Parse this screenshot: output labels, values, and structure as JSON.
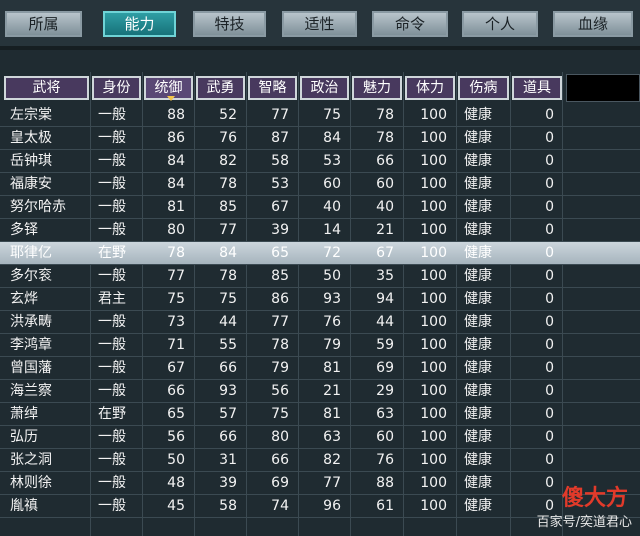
{
  "tabs": [
    {
      "label": "所属",
      "active": false
    },
    {
      "label": "能力",
      "active": true
    },
    {
      "label": "特技",
      "active": false
    },
    {
      "label": "适性",
      "active": false
    },
    {
      "label": "命令",
      "active": false
    },
    {
      "label": "个人",
      "active": false
    },
    {
      "label": "血缘",
      "active": false
    }
  ],
  "columns": [
    "武将",
    "身份",
    "统御",
    "武勇",
    "智略",
    "政治",
    "魅力",
    "体力",
    "伤病",
    "道具"
  ],
  "sorted_column": "统御",
  "rows": [
    [
      "左宗棠",
      "一般",
      "88",
      "52",
      "77",
      "75",
      "78",
      "100",
      "健康",
      "0"
    ],
    [
      "皇太极",
      "一般",
      "86",
      "76",
      "87",
      "84",
      "78",
      "100",
      "健康",
      "0"
    ],
    [
      "岳钟琪",
      "一般",
      "84",
      "82",
      "58",
      "53",
      "66",
      "100",
      "健康",
      "0"
    ],
    [
      "福康安",
      "一般",
      "84",
      "78",
      "53",
      "60",
      "60",
      "100",
      "健康",
      "0"
    ],
    [
      "努尔哈赤",
      "一般",
      "81",
      "85",
      "67",
      "40",
      "40",
      "100",
      "健康",
      "0"
    ],
    [
      "多铎",
      "一般",
      "80",
      "77",
      "39",
      "14",
      "21",
      "100",
      "健康",
      "0"
    ],
    [
      "耶律亿",
      "在野",
      "78",
      "84",
      "65",
      "72",
      "67",
      "100",
      "健康",
      "0"
    ],
    [
      "多尔衮",
      "一般",
      "77",
      "78",
      "85",
      "50",
      "35",
      "100",
      "健康",
      "0"
    ],
    [
      "玄烨",
      "君主",
      "75",
      "75",
      "86",
      "93",
      "94",
      "100",
      "健康",
      "0"
    ],
    [
      "洪承畴",
      "一般",
      "73",
      "44",
      "77",
      "76",
      "44",
      "100",
      "健康",
      "0"
    ],
    [
      "李鸿章",
      "一般",
      "71",
      "55",
      "78",
      "79",
      "59",
      "100",
      "健康",
      "0"
    ],
    [
      "曾国藩",
      "一般",
      "67",
      "66",
      "79",
      "81",
      "69",
      "100",
      "健康",
      "0"
    ],
    [
      "海兰察",
      "一般",
      "66",
      "93",
      "56",
      "21",
      "29",
      "100",
      "健康",
      "0"
    ],
    [
      "萧绰",
      "在野",
      "65",
      "57",
      "75",
      "81",
      "63",
      "100",
      "健康",
      "0"
    ],
    [
      "弘历",
      "一般",
      "56",
      "66",
      "80",
      "63",
      "60",
      "100",
      "健康",
      "0"
    ],
    [
      "张之洞",
      "一般",
      "50",
      "31",
      "66",
      "82",
      "76",
      "100",
      "健康",
      "0"
    ],
    [
      "林则徐",
      "一般",
      "48",
      "39",
      "69",
      "77",
      "88",
      "100",
      "健康",
      "0"
    ],
    [
      "胤禛",
      "一般",
      "45",
      "58",
      "74",
      "96",
      "61",
      "100",
      "健康",
      "0"
    ]
  ],
  "highlighted_row": 6,
  "watermark": {
    "logo": "傻大方",
    "text": "百家号/奕道君心"
  },
  "colors": {
    "bg": "#1f2b31",
    "header": "#48395e",
    "active_tab": "#17727a",
    "highlight": "#b3c0c8"
  }
}
